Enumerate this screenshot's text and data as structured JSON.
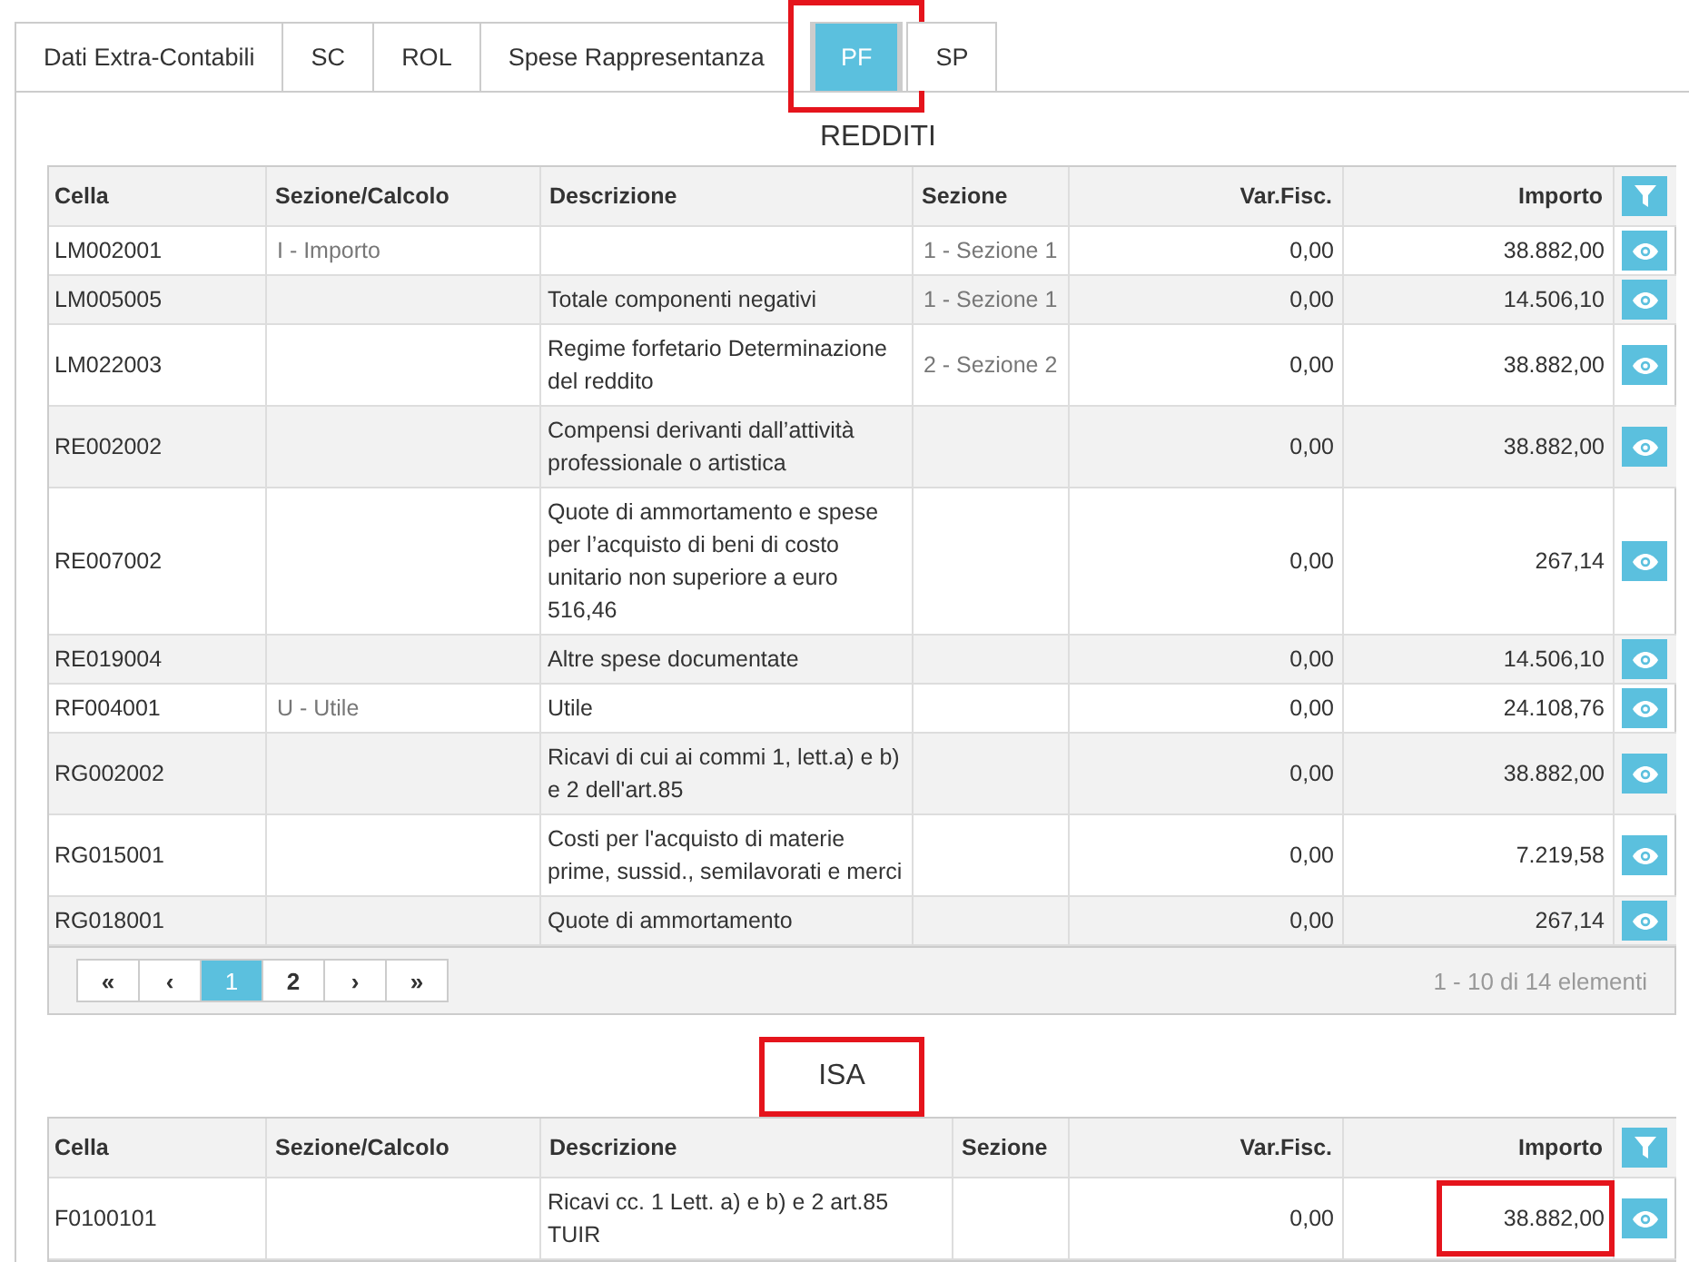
{
  "tabs": [
    {
      "label": "Dati Extra-Contabili",
      "selected": false,
      "highlighted": false
    },
    {
      "label": "SC",
      "selected": false,
      "highlighted": false
    },
    {
      "label": "ROL",
      "selected": false,
      "highlighted": false
    },
    {
      "label": "Spese Rappresentanza",
      "selected": false,
      "highlighted": false
    },
    {
      "label": "PF",
      "selected": true,
      "highlighted": true
    },
    {
      "label": "SP",
      "selected": false,
      "highlighted": false
    }
  ],
  "sections": [
    {
      "title": "REDDITI",
      "title_highlighted": false,
      "columns": [
        "Cella",
        "Sezione/Calcolo",
        "Descrizione",
        "Sezione",
        "Var.Fisc.",
        "Importo"
      ],
      "rows": [
        {
          "cella": "LM002001",
          "sezione_calcolo": "I - Importo",
          "sezione": "1 - Sezione 1",
          "var_fisc": "0,00",
          "importo": "38.882,00",
          "importo_highlighted": false
        },
        {
          "cella": "LM005005",
          "descrizione": "Totale componenti negativi",
          "sezione": "1 - Sezione 1",
          "var_fisc": "0,00",
          "importo": "14.506,10",
          "importo_highlighted": false
        },
        {
          "cella": "LM022003",
          "descrizione": "Regime forfetario Determinazione del reddito",
          "sezione": "2 - Sezione 2",
          "var_fisc": "0,00",
          "importo": "38.882,00",
          "importo_highlighted": false
        },
        {
          "cella": "RE002002",
          "descrizione": "Compensi derivanti dall’attività professionale o artistica",
          "var_fisc": "0,00",
          "importo": "38.882,00",
          "importo_highlighted": false
        },
        {
          "cella": "RE007002",
          "descrizione": "Quote di ammortamento e spese per l’acquisto di beni di costo unitario non superiore a euro 516,46",
          "var_fisc": "0,00",
          "importo": "267,14",
          "importo_highlighted": false
        },
        {
          "cella": "RE019004",
          "descrizione": "Altre spese documentate",
          "var_fisc": "0,00",
          "importo": "14.506,10",
          "importo_highlighted": false
        },
        {
          "cella": "RF004001",
          "sezione_calcolo": "U - Utile",
          "descrizione": "Utile",
          "var_fisc": "0,00",
          "importo": "24.108,76",
          "importo_highlighted": false
        },
        {
          "cella": "RG002002",
          "descrizione": "Ricavi di cui ai commi 1, lett.a) e b) e 2 dell'art.85",
          "var_fisc": "0,00",
          "importo": "38.882,00",
          "importo_highlighted": false
        },
        {
          "cella": "RG015001",
          "descrizione": "Costi per l'acquisto di materie prime, sussid., semilavorati e merci",
          "var_fisc": "0,00",
          "importo": "7.219,58",
          "importo_highlighted": false
        },
        {
          "cella": "RG018001",
          "descrizione": "Quote di ammortamento",
          "var_fisc": "0,00",
          "importo": "267,14",
          "importo_highlighted": false
        }
      ],
      "pagination": {
        "pages": [
          {
            "label": "«",
            "selected": false
          },
          {
            "label": "‹",
            "selected": false
          },
          {
            "label": "1",
            "selected": true
          },
          {
            "label": "2",
            "selected": false
          },
          {
            "label": "›",
            "selected": false
          },
          {
            "label": "»",
            "selected": false
          }
        ],
        "summary": "1 - 10 di 14 elementi"
      }
    },
    {
      "title": "ISA",
      "title_highlighted": true,
      "columns": [
        "Cella",
        "Sezione/Calcolo",
        "Descrizione",
        "Sezione",
        "Var.Fisc.",
        "Importo"
      ],
      "rows": [
        {
          "cella": "F0100101",
          "descrizione": "Ricavi cc. 1 Lett. a) e b) e 2 art.85 TUIR",
          "var_fisc": "0,00",
          "importo": "38.882,00",
          "importo_highlighted": true
        }
      ]
    }
  ]
}
